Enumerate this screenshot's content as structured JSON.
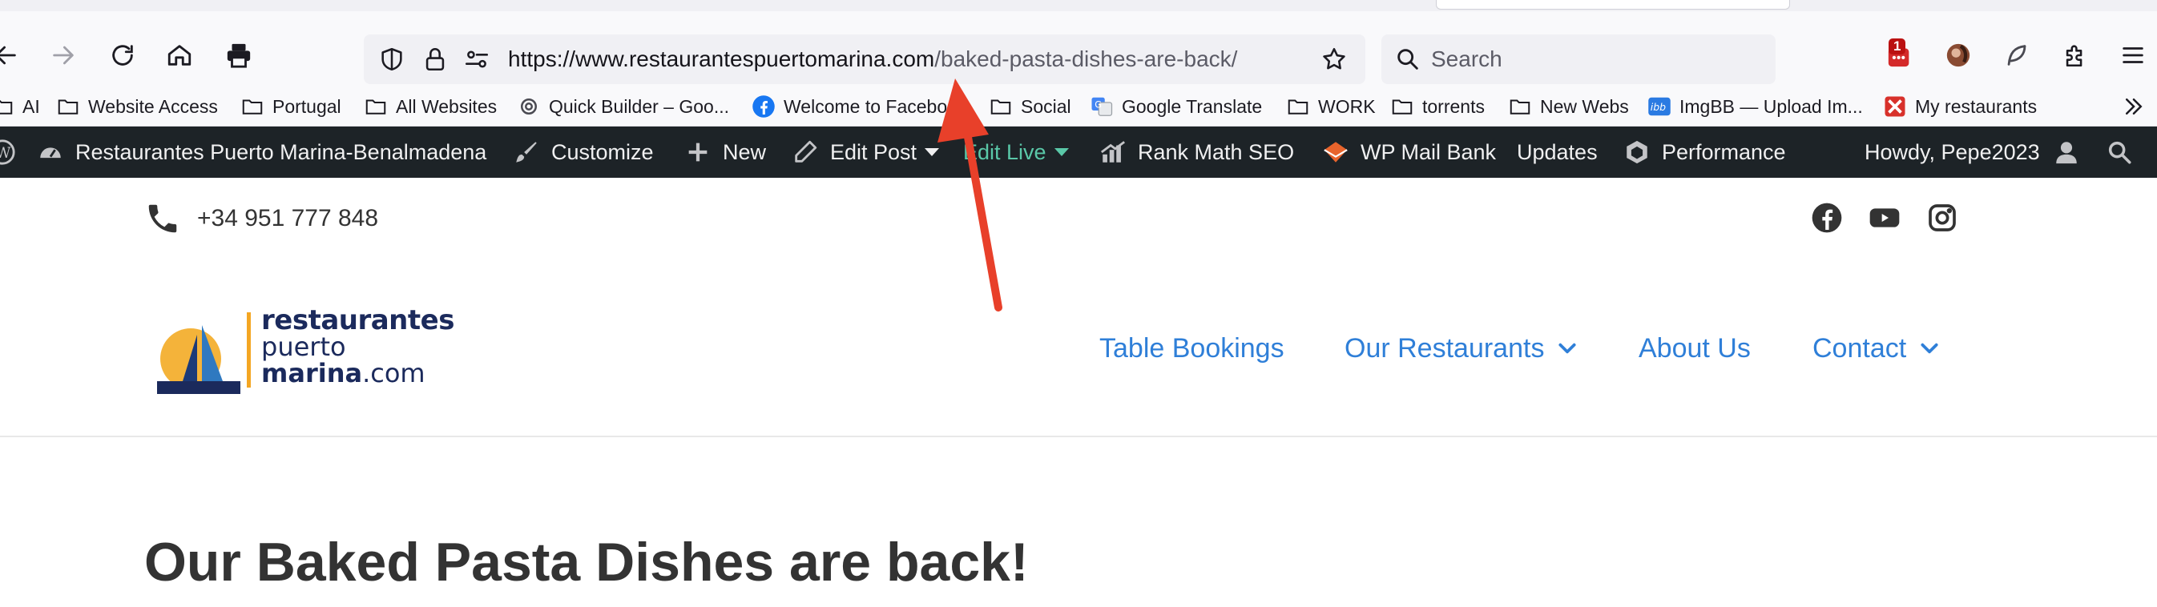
{
  "browser": {
    "url_domain": "https://www.restaurantespuertomarina.com",
    "url_path": "/baked-pasta-dishes-are-back/",
    "search_placeholder": "Search",
    "extension_badge": "1",
    "nav_icons": [
      "back-icon",
      "forward-icon",
      "reload-icon",
      "home-icon",
      "print-icon"
    ],
    "url_icons": [
      "shield-icon",
      "lock-icon",
      "permissions-icon",
      "bookmark-star-icon"
    ],
    "right_icons": [
      "extension-badge-icon",
      "profile-avatar-icon",
      "feather-extension-icon",
      "extensions-puzzle-icon",
      "menu-icon"
    ]
  },
  "bookmarks": {
    "items": [
      {
        "label": "AI",
        "icon": "folder-icon"
      },
      {
        "label": "Website Access",
        "icon": "folder-icon"
      },
      {
        "label": "Portugal",
        "icon": "folder-icon"
      },
      {
        "label": "All Websites",
        "icon": "folder-icon"
      },
      {
        "label": "Quick Builder – Goo...",
        "icon": "site-icon"
      },
      {
        "label": "Welcome to Facebo",
        "icon": "facebook-icon"
      },
      {
        "label": "Social",
        "icon": "folder-icon"
      },
      {
        "label": "Google Translate",
        "icon": "translate-icon"
      },
      {
        "label": "WORK",
        "icon": "folder-icon"
      },
      {
        "label": "torrents",
        "icon": "folder-icon"
      },
      {
        "label": "New Webs",
        "icon": "folder-icon"
      },
      {
        "label": "ImgBB — Upload Im...",
        "icon": "imgbb-icon"
      },
      {
        "label": "My restaurants",
        "icon": "restaurant-icon"
      }
    ],
    "overflow_icon": "chevron-double-right-icon"
  },
  "adminbar": {
    "site_name": "Restaurantes Puerto Marina-Benalmadena",
    "customize": "Customize",
    "new": "New",
    "edit_post": "Edit Post",
    "edit_live": "Edit Live",
    "rank_math": "Rank Math SEO",
    "mail_bank": "WP Mail Bank",
    "updates": "Updates",
    "performance": "Performance",
    "howdy": "Howdy, Pepe2023",
    "colors": {
      "bar": "#1d2327",
      "edit_live": "#5ac8a8"
    }
  },
  "site": {
    "phone": "+34 951 777 848",
    "social_icons": [
      "facebook-icon",
      "youtube-icon",
      "instagram-icon"
    ],
    "logo": {
      "line1": "restaurantes",
      "line2": "puerto",
      "line3_bold": "marina",
      "line3_rest": ".com"
    },
    "nav": {
      "table_bookings": "Table Bookings",
      "our_restaurants": "Our Restaurants",
      "about_us": "About Us",
      "contact": "Contact"
    },
    "page_title": "Our Baked Pasta Dishes are back!",
    "colors": {
      "nav_link": "#2f7fd8",
      "annotation_arrow": "#e8402a"
    }
  }
}
